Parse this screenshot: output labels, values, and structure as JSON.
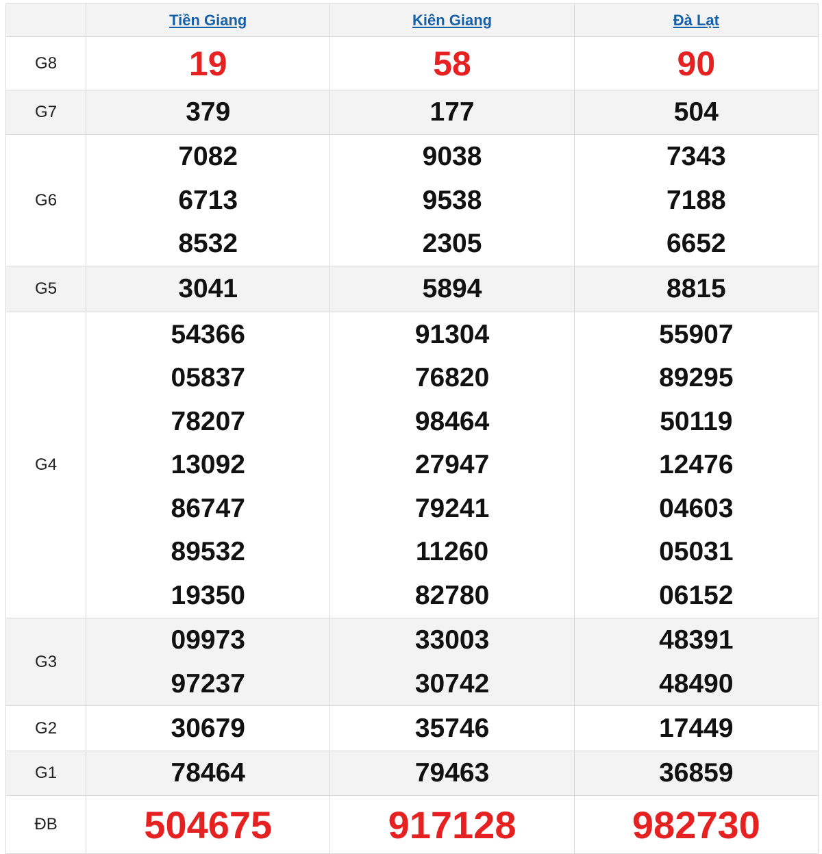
{
  "provinces": [
    {
      "name": "Tiền Giang"
    },
    {
      "name": "Kiên Giang"
    },
    {
      "name": "Đà Lạt"
    }
  ],
  "colors": {
    "header_link": "#1560a8",
    "highlight_red": "#e52121",
    "shaded_row": "#f3f3f3"
  },
  "prizes": [
    {
      "label": "G8",
      "values": [
        [
          "19"
        ],
        [
          "58"
        ],
        [
          "90"
        ]
      ]
    },
    {
      "label": "G7",
      "values": [
        [
          "379"
        ],
        [
          "177"
        ],
        [
          "504"
        ]
      ]
    },
    {
      "label": "G6",
      "values": [
        [
          "7082",
          "6713",
          "8532"
        ],
        [
          "9038",
          "9538",
          "2305"
        ],
        [
          "7343",
          "7188",
          "6652"
        ]
      ]
    },
    {
      "label": "G5",
      "values": [
        [
          "3041"
        ],
        [
          "5894"
        ],
        [
          "8815"
        ]
      ]
    },
    {
      "label": "G4",
      "values": [
        [
          "54366",
          "05837",
          "78207",
          "13092",
          "86747",
          "89532",
          "19350"
        ],
        [
          "91304",
          "76820",
          "98464",
          "27947",
          "79241",
          "11260",
          "82780"
        ],
        [
          "55907",
          "89295",
          "50119",
          "12476",
          "04603",
          "05031",
          "06152"
        ]
      ]
    },
    {
      "label": "G3",
      "values": [
        [
          "09973",
          "97237"
        ],
        [
          "33003",
          "30742"
        ],
        [
          "48391",
          "48490"
        ]
      ]
    },
    {
      "label": "G2",
      "values": [
        [
          "30679"
        ],
        [
          "35746"
        ],
        [
          "17449"
        ]
      ]
    },
    {
      "label": "G1",
      "values": [
        [
          "78464"
        ],
        [
          "79463"
        ],
        [
          "36859"
        ]
      ]
    },
    {
      "label": "ĐB",
      "values": [
        [
          "504675"
        ],
        [
          "917128"
        ],
        [
          "982730"
        ]
      ]
    }
  ]
}
